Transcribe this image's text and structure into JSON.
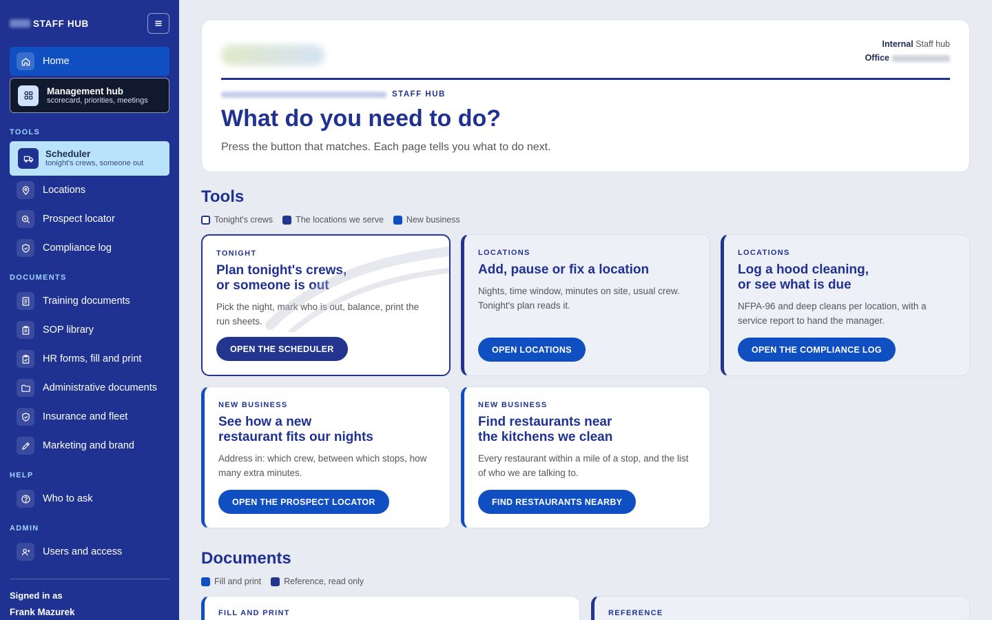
{
  "sidebar": {
    "brand": "STAFF HUB",
    "home": "Home",
    "management": {
      "title": "Management hub",
      "subtitle": "scorecard, priorities, meetings"
    },
    "tools_label": "TOOLS",
    "scheduler": {
      "title": "Scheduler",
      "subtitle": "tonight's crews, someone out"
    },
    "tools": [
      "Locations",
      "Prospect locator",
      "Compliance log"
    ],
    "documents_label": "DOCUMENTS",
    "documents": [
      "Training documents",
      "SOP library",
      "HR forms, fill and print",
      "Administrative documents",
      "Insurance and fleet",
      "Marketing and brand"
    ],
    "help_label": "HELP",
    "help": [
      "Who to ask"
    ],
    "admin_label": "ADMIN",
    "admin": [
      "Users and access"
    ],
    "signed_in_label": "Signed in as",
    "user_name": "Frank Mazurek"
  },
  "hero": {
    "internal_label": "Internal",
    "internal_value": "Staff hub",
    "office_label": "Office",
    "eyebrow": "STAFF HUB",
    "title": "What do you need to do?",
    "subtitle": "Press the button that matches. Each page tells you what to do next."
  },
  "tools": {
    "title": "Tools",
    "legend": [
      "Tonight's crews",
      "The locations we serve",
      "New business"
    ],
    "cards": [
      {
        "eyebrow": "TONIGHT",
        "title": "Plan tonight's crews,\nor someone is out",
        "desc": "Pick the night, mark who is out, balance, print the\nrun sheets.",
        "button": "OPEN THE SCHEDULER"
      },
      {
        "eyebrow": "LOCATIONS",
        "title": "Add, pause or fix a location",
        "desc": "Nights, time window, minutes on site, usual crew.\nTonight's plan reads it.",
        "button": "OPEN LOCATIONS"
      },
      {
        "eyebrow": "LOCATIONS",
        "title": "Log a hood cleaning,\nor see what is due",
        "desc": "NFPA-96 and deep cleans per location, with a\nservice report to hand the manager.",
        "button": "OPEN THE COMPLIANCE LOG"
      },
      {
        "eyebrow": "NEW BUSINESS",
        "title": "See how a new\nrestaurant fits our nights",
        "desc": "Address in: which crew, between which stops, how\nmany extra minutes.",
        "button": "OPEN THE PROSPECT LOCATOR"
      },
      {
        "eyebrow": "NEW BUSINESS",
        "title": "Find restaurants near\nthe kitchens we clean",
        "desc": "Every restaurant within a mile of a stop, and the list\nof who we are talking to.",
        "button": "FIND RESTAURANTS NEARBY"
      }
    ]
  },
  "documents": {
    "title": "Documents",
    "legend": [
      "Fill and print",
      "Reference, read only"
    ],
    "cards": [
      {
        "eyebrow": "FILL AND PRINT"
      },
      {
        "eyebrow": "REFERENCE"
      }
    ]
  },
  "colors": {
    "navy": "#1f3291",
    "accent_blue": "#0f4fc2",
    "selected_bg": "#b9e2fb"
  }
}
